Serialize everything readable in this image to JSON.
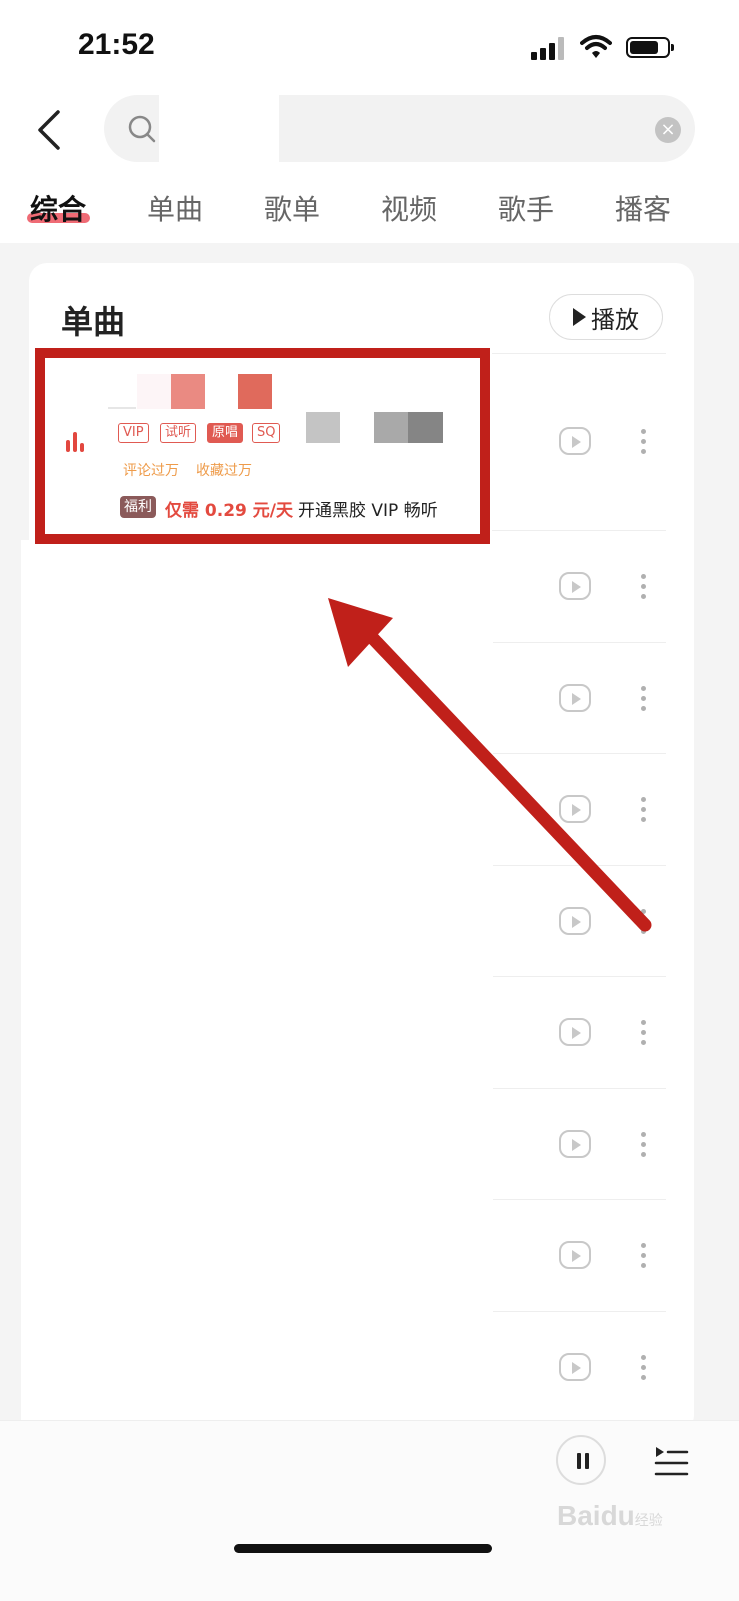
{
  "status_bar": {
    "time": "21:52"
  },
  "search": {
    "placeholder": "",
    "clear_icon": "×"
  },
  "tabs": [
    "综合",
    "单曲",
    "歌单",
    "视频",
    "歌手",
    "播客"
  ],
  "section": {
    "title": "单曲",
    "play_all_label": "播放"
  },
  "first_song": {
    "tags": [
      "VIP",
      "试听",
      "原唱",
      "SQ"
    ],
    "stats": [
      "评论过万",
      "收藏过万"
    ],
    "benefit_badge": "福利",
    "benefit_price": "仅需 0.29 元/天",
    "benefit_text": "开通黑胶 VIP 畅听"
  },
  "watermark": {
    "brand": "Baidu",
    "cn": "经验"
  },
  "colors": {
    "accent": "#e05a52",
    "highlight_box": "#c0201a",
    "tab_underline": "#ef6b75"
  }
}
